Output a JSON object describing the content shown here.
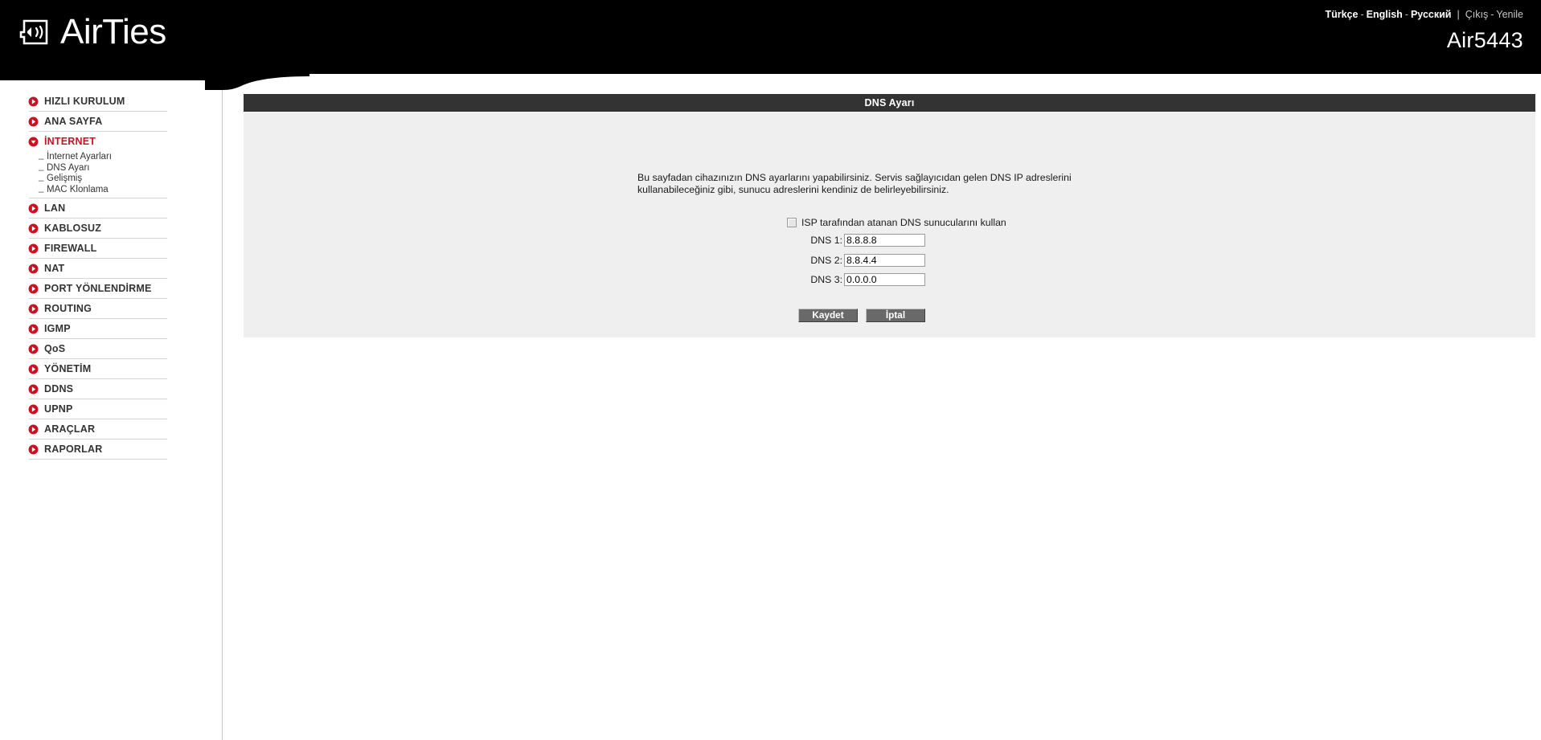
{
  "header": {
    "logo_text": "AirTies",
    "logo_icon": "airties-wifi-logo-icon",
    "languages": [
      {
        "label": "Türkçe",
        "active": true
      },
      {
        "label": "English",
        "active": true
      },
      {
        "label": "Русский",
        "active": true
      }
    ],
    "lang_separator": "-",
    "divider": "|",
    "session_links": [
      {
        "label": "Çıkış"
      },
      {
        "label": "Yenile"
      }
    ],
    "model_name": "Air5443",
    "background_color": "#000000"
  },
  "sidebar": {
    "items": [
      {
        "label": "HIZLI KURULUM",
        "icon": "arrow-right-circle-icon",
        "expanded": false,
        "children": []
      },
      {
        "label": "ANA SAYFA",
        "icon": "arrow-right-circle-icon",
        "expanded": false,
        "children": []
      },
      {
        "label": "İNTERNET",
        "icon": "arrow-down-circle-icon",
        "expanded": true,
        "children": [
          "İnternet Ayarları",
          "DNS Ayarı",
          "Gelişmiş",
          "MAC Klonlama"
        ]
      },
      {
        "label": "LAN",
        "icon": "arrow-right-circle-icon",
        "expanded": false,
        "children": []
      },
      {
        "label": "KABLOSUZ",
        "icon": "arrow-right-circle-icon",
        "expanded": false,
        "children": []
      },
      {
        "label": "FIREWALL",
        "icon": "arrow-right-circle-icon",
        "expanded": false,
        "children": []
      },
      {
        "label": "NAT",
        "icon": "arrow-right-circle-icon",
        "expanded": false,
        "children": []
      },
      {
        "label": "PORT YÖNLENDİRME",
        "icon": "arrow-right-circle-icon",
        "expanded": false,
        "children": []
      },
      {
        "label": "ROUTING",
        "icon": "arrow-right-circle-icon",
        "expanded": false,
        "children": []
      },
      {
        "label": "IGMP",
        "icon": "arrow-right-circle-icon",
        "expanded": false,
        "children": []
      },
      {
        "label": "QoS",
        "icon": "arrow-right-circle-icon",
        "expanded": false,
        "children": []
      },
      {
        "label": "YÖNETİM",
        "icon": "arrow-right-circle-icon",
        "expanded": false,
        "children": []
      },
      {
        "label": "DDNS",
        "icon": "arrow-right-circle-icon",
        "expanded": false,
        "children": []
      },
      {
        "label": "UPNP",
        "icon": "arrow-right-circle-icon",
        "expanded": false,
        "children": []
      },
      {
        "label": "ARAÇLAR",
        "icon": "arrow-right-circle-icon",
        "expanded": false,
        "children": []
      },
      {
        "label": "RAPORLAR",
        "icon": "arrow-right-circle-icon",
        "expanded": false,
        "children": []
      }
    ],
    "accent_color": "#cc1122"
  },
  "panel": {
    "title": "DNS Ayarı",
    "title_bg": "#333333",
    "body_bg": "#efefef",
    "description": "Bu sayfadan cihazınızın DNS ayarlarını yapabilirsiniz. Servis sağlayıcıdan gelen DNS IP adreslerini kullanabileceğiniz gibi, sunucu adreslerini kendiniz de belirleyebilirsiniz.",
    "isp_checkbox": {
      "label": "ISP tarafından atanan DNS sunucularını kullan",
      "checked": false
    },
    "dns_fields": [
      {
        "label": "DNS 1:",
        "value": "8.8.8.8"
      },
      {
        "label": "DNS 2:",
        "value": "8.8.4.4"
      },
      {
        "label": "DNS 3:",
        "value": "0.0.0.0"
      }
    ],
    "buttons": {
      "save": "Kaydet",
      "cancel": "İptal"
    }
  }
}
